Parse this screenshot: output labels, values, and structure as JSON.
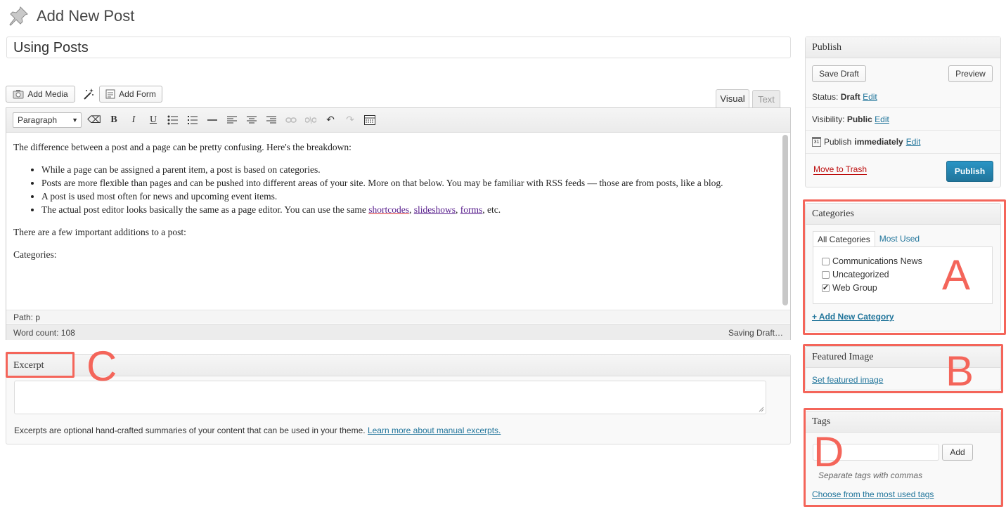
{
  "header": {
    "title": "Add New Post"
  },
  "post": {
    "title_value": "Using Posts"
  },
  "media_buttons": {
    "add_media": "Add Media",
    "add_form": "Add Form"
  },
  "editor": {
    "tabs": {
      "visual": "Visual",
      "text": "Text"
    },
    "format_select": "Paragraph",
    "content": {
      "p1": "The difference between a post and a page can be pretty confusing. Here's the breakdown:",
      "bullets": [
        "While a page can be assigned a parent item, a post is based on categories.",
        "Posts are more flexible than pages and can be pushed into different areas of your site. More on that below. You may be familiar with RSS feeds — those are from posts, like a blog.",
        "A post is used most often for news and upcoming event items."
      ],
      "b4_pre": "The actual post editor looks basically the same as a page editor. You can use the same ",
      "b4_link1": "shortcodes",
      "b4_sep1": ", ",
      "b4_link2": "slideshows",
      "b4_sep2": ", ",
      "b4_link3": "forms",
      "b4_post": ", etc.",
      "p2": "There are a few important additions to a post:",
      "p3": "Categories:"
    },
    "path": "Path: p",
    "word_count": "Word count: 108",
    "saving": "Saving Draft…"
  },
  "excerpt": {
    "title": "Excerpt",
    "help_text": "Excerpts are optional hand-crafted summaries of your content that can be used in your theme.",
    "help_link": "Learn more about manual excerpts."
  },
  "publish": {
    "title": "Publish",
    "save_draft": "Save Draft",
    "preview": "Preview",
    "status_label": "Status:",
    "status_value": "Draft",
    "visibility_label": "Visibility:",
    "visibility_value": "Public",
    "publish_label": "Publish",
    "publish_value": "immediately",
    "edit": "Edit",
    "calendar_day": "31",
    "trash": "Move to Trash",
    "publish_button": "Publish"
  },
  "categories": {
    "title": "Categories",
    "tab_all": "All Categories",
    "tab_most_used": "Most Used",
    "items": [
      {
        "label": "Communications News",
        "checked": false
      },
      {
        "label": "Uncategorized",
        "checked": false
      },
      {
        "label": "Web Group",
        "checked": true
      }
    ],
    "add_new": "+ Add New Category"
  },
  "featured_image": {
    "title": "Featured Image",
    "link": "Set featured image"
  },
  "tags": {
    "title": "Tags",
    "add": "Add",
    "help": "Separate tags with commas",
    "choose": "Choose from the most used tags"
  },
  "annotations": {
    "a": "A",
    "b": "B",
    "c": "C",
    "d": "D"
  },
  "colors": {
    "annotation_red": "#f4655a",
    "primary_blue": "#21759b",
    "trash_red": "#bc0b0b"
  }
}
